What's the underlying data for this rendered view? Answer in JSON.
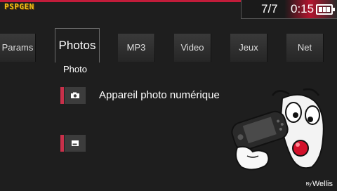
{
  "header": {
    "logo": "PSPGEN",
    "date": "7/7",
    "time": "0:15"
  },
  "tabs": [
    {
      "label": "Params"
    },
    {
      "label": "Photos"
    },
    {
      "label": "MP3"
    },
    {
      "label": "Video"
    },
    {
      "label": "Jeux"
    },
    {
      "label": "Net"
    }
  ],
  "submenu": {
    "title": "Photo",
    "items": [
      {
        "label": "Appareil photo numérique",
        "icon": "camera-icon"
      },
      {
        "label": "",
        "icon": "memory-card-icon"
      }
    ]
  },
  "credit": {
    "prefix": "By",
    "author": "Wellis"
  },
  "colors": {
    "accent": "#c21c3a",
    "marker": "#c9304a",
    "logo": "#f2c418"
  },
  "battery_level": 1.0
}
